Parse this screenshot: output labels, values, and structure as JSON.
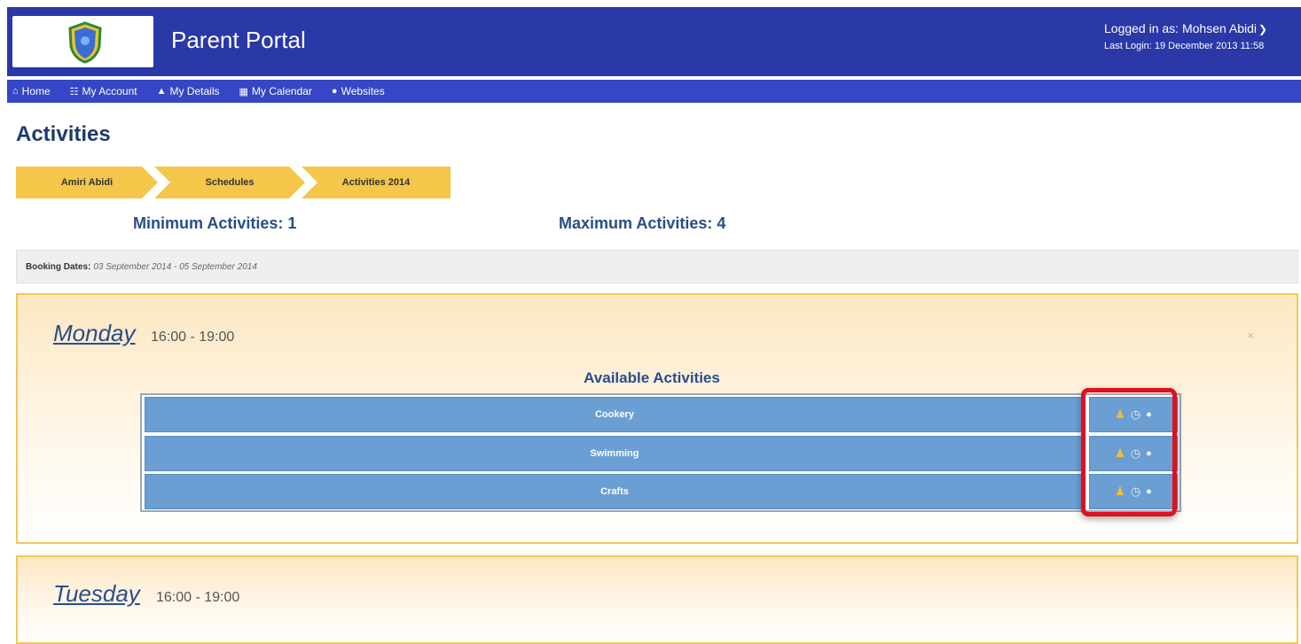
{
  "header": {
    "app_title": "Parent Portal",
    "logged_in": "Logged in as: Mohsen Abidi",
    "last_login": "Last Login: 19 December 2013 11:58"
  },
  "nav": {
    "items": [
      {
        "label": "Home",
        "icon": "home-icon"
      },
      {
        "label": "My Account",
        "icon": "id-card-icon"
      },
      {
        "label": "My Details",
        "icon": "user-icon"
      },
      {
        "label": "My Calendar",
        "icon": "calendar-icon"
      },
      {
        "label": "Websites",
        "icon": "globe-icon"
      }
    ]
  },
  "page": {
    "title": "Activities",
    "breadcrumb": [
      "Amiri Abidi",
      "Schedules",
      "Activities 2014"
    ],
    "min_activities": "Minimum Activities: 1",
    "max_activities": "Maximum Activities: 4",
    "booking_label": "Booking Dates:",
    "booking_value": "03 September 2014 - 05 September 2014"
  },
  "days": [
    {
      "name": "Monday",
      "time": "16:00 - 19:00",
      "available_title": "Available Activities",
      "close": "×",
      "activities": [
        "Cookery",
        "Swimming",
        "Crafts"
      ]
    },
    {
      "name": "Tuesday",
      "time": "16:00 - 19:00"
    }
  ],
  "colors": {
    "header_bg": "#2a38a8",
    "nav_bg": "#3646c4",
    "crumb_bg": "#f4c64a",
    "activity_row": "#6b9fd4",
    "highlight": "#e01020"
  }
}
